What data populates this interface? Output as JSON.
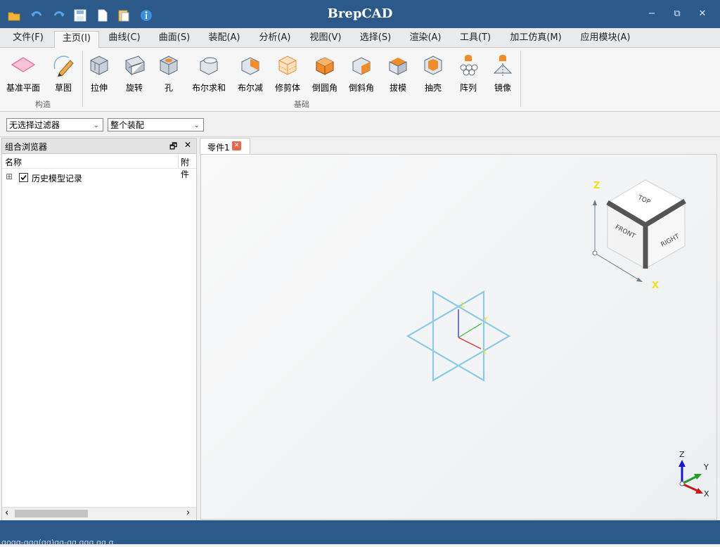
{
  "app": {
    "title": "BrepCAD"
  },
  "quick_access": [
    {
      "name": "open-folder-icon",
      "color": "#f3b63a"
    },
    {
      "name": "undo-icon",
      "color": "#5aa0e6"
    },
    {
      "name": "redo-icon",
      "color": "#5aa0e6"
    },
    {
      "name": "save-icon",
      "color": "#ffffff"
    },
    {
      "name": "new-document-icon",
      "color": "#ffffff"
    },
    {
      "name": "paste-icon",
      "color": "#f3d27a"
    },
    {
      "name": "info-icon",
      "color": "#3b8fdc"
    }
  ],
  "window_controls": {
    "minimize": "−",
    "restore": "⧉",
    "close": "✕"
  },
  "menu_tabs": [
    "文件(F)",
    "主页(I)",
    "曲线(C)",
    "曲面(S)",
    "装配(A)",
    "分析(A)",
    "视图(V)",
    "选择(S)",
    "渲染(A)",
    "工具(T)",
    "加工仿真(M)",
    "应用模块(A)"
  ],
  "active_menu_tab": "主页(I)",
  "ribbon": {
    "groups": [
      {
        "label": "构造",
        "buttons": [
          "基准平面",
          "草图"
        ]
      },
      {
        "label": "基础",
        "buttons": [
          "拉伸",
          "旋转",
          "孔",
          "布尔求和",
          "布尔减",
          "修剪体",
          "倒圆角",
          "倒斜角",
          "拔模",
          "抽壳",
          "阵列",
          "镜像"
        ]
      }
    ]
  },
  "filters": {
    "selection_filter": "无选择过滤器",
    "scope": "整个装配"
  },
  "left_panel": {
    "title": "组合浏览器",
    "float_icon": "🗗",
    "close_icon": "✕",
    "columns": [
      "名称",
      "附件"
    ],
    "tree": [
      {
        "label": "历史模型记录",
        "checked": true,
        "expander": "⊞"
      }
    ],
    "scroll_left": "‹",
    "scroll_right": "›"
  },
  "document_tab": {
    "label": "零件1",
    "close_icon": "✕"
  },
  "view_cube": {
    "top": "TOP",
    "front": "FRONT",
    "right": "RIGHT",
    "axis_z": "Z",
    "axis_x": "X"
  },
  "triad": {
    "z": "Z",
    "y": "Y",
    "x": "X"
  },
  "status": {
    "text": "ɑoɑɑ-ɑɑɑ(ɑɑ)ɑɑ-ɑɑ ɑɑɑ ɑɑ ɑ"
  },
  "colors": {
    "title_bar": "#2b5a8a",
    "sketch_plane": "#8ecbe6",
    "accent_orange": "#f08c2a"
  }
}
